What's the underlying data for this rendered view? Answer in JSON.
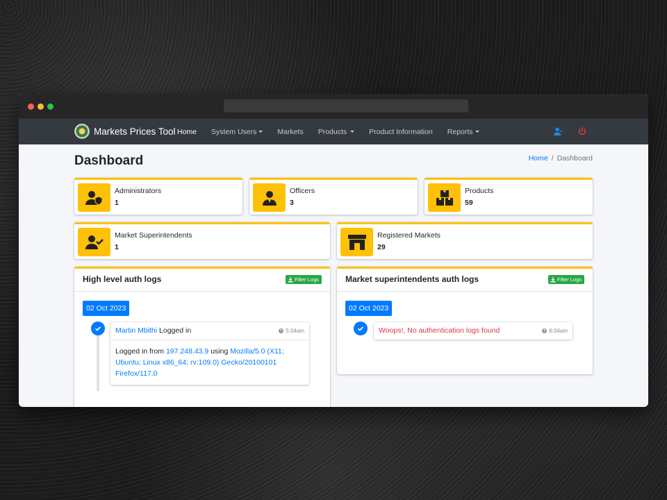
{
  "app": {
    "brand": "Markets Prices Tool",
    "nav": [
      {
        "label": "Home",
        "active": true,
        "dropdown": false
      },
      {
        "label": "System Users",
        "active": false,
        "dropdown": true
      },
      {
        "label": "Markets",
        "active": false,
        "dropdown": false
      },
      {
        "label": "Products",
        "active": false,
        "dropdown": true
      },
      {
        "label": "Product Information",
        "active": false,
        "dropdown": false
      },
      {
        "label": "Reports",
        "active": false,
        "dropdown": true
      }
    ],
    "icons": {
      "user": "user-icon",
      "power": "power-icon"
    }
  },
  "page": {
    "title": "Dashboard",
    "breadcrumb": {
      "home": "Home",
      "sep": "/",
      "current": "Dashboard"
    }
  },
  "stats": [
    {
      "label": "Administrators",
      "value": "1",
      "icon": "admin-shield-icon"
    },
    {
      "label": "Officers",
      "value": "3",
      "icon": "officer-icon"
    },
    {
      "label": "Products",
      "value": "59",
      "icon": "boxes-icon"
    },
    {
      "label": "Market Superintendents",
      "value": "1",
      "icon": "user-check-icon"
    },
    {
      "label": "Registered Markets",
      "value": "29",
      "icon": "store-icon"
    }
  ],
  "logs": {
    "high": {
      "title": "High level auth logs",
      "filter": "Filter Logs",
      "date": "02 Oct 2023",
      "entry": {
        "user": "Martin Mbithi",
        "action": " Logged in",
        "time": "5:04am",
        "body_prefix": "Logged in from ",
        "ip": "197.248.43.9",
        "body_mid": " using ",
        "agent": "Mozilla/5.0 (X11; Ubuntu; Linux x86_64; rv:109.0) Gecko/20100101 Firefox/117.0"
      }
    },
    "market": {
      "title": "Market superintendents auth logs",
      "filter": "Filter Logs",
      "date": "02 Oct 2023",
      "entry": {
        "message": "Woops!, No authentication logs found",
        "time": "6:04am"
      }
    }
  },
  "colors": {
    "accent": "#ffc107",
    "primary": "#007bff",
    "success": "#28a745",
    "danger": "#dc3545",
    "navbar": "#343a40"
  }
}
